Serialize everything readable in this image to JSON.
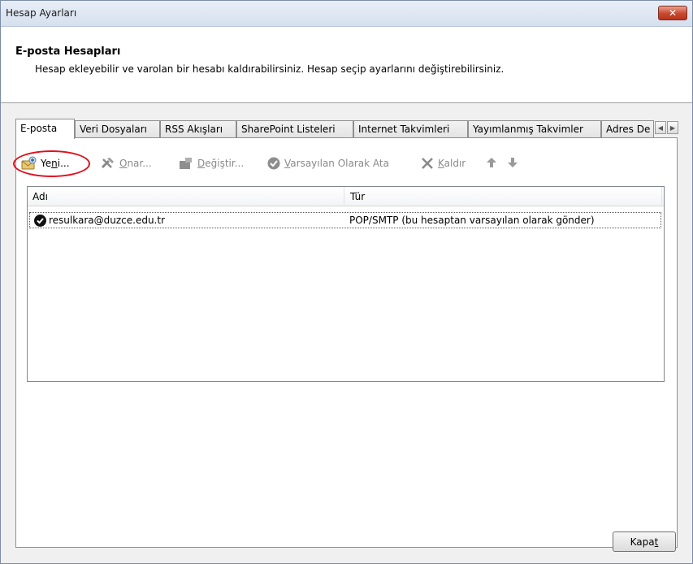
{
  "window": {
    "title": "Hesap Ayarları",
    "close_glyph": "✕"
  },
  "header": {
    "title": "E-posta Hesapları",
    "description": "Hesap ekleyebilir ve varolan bir hesabı kaldırabilirsiniz. Hesap seçip ayarlarını değiştirebilirsiniz."
  },
  "tabs": [
    {
      "label": "E-posta",
      "active": true
    },
    {
      "label": "Veri Dosyaları"
    },
    {
      "label": "RSS Akışları"
    },
    {
      "label": "SharePoint Listeleri"
    },
    {
      "label": "Internet Takvimleri"
    },
    {
      "label": "Yayımlanmış Takvimler"
    },
    {
      "label": "Adres De"
    }
  ],
  "tab_scroll": {
    "left": "◀",
    "right": "▶"
  },
  "toolbar": {
    "new": {
      "prefix": "Ye",
      "underline": "n",
      "suffix": "i...",
      "icon": "new-account-icon",
      "enabled": true
    },
    "repair": {
      "prefix": "",
      "underline": "O",
      "suffix": "nar...",
      "icon": "repair-tools-icon",
      "enabled": false
    },
    "change": {
      "prefix": "",
      "underline": "D",
      "suffix": "eğiştir...",
      "icon": "change-icon",
      "enabled": false
    },
    "set_default": {
      "prefix": "",
      "underline": "V",
      "suffix": "arsayılan Olarak Ata",
      "icon": "check-circle-icon",
      "enabled": false
    },
    "remove": {
      "prefix": "",
      "underline": "K",
      "suffix": "aldır",
      "icon": "x-icon",
      "enabled": false
    },
    "move_up": {
      "icon": "arrow-up-icon"
    },
    "move_down": {
      "icon": "arrow-down-icon"
    }
  },
  "accounts_table": {
    "columns": [
      "Adı",
      "Tür"
    ],
    "rows": [
      {
        "name": "resulkara@duzce.edu.tr",
        "type": "POP/SMTP (bu hesaptan varsayılan olarak gönder)",
        "default": true
      }
    ]
  },
  "footer": {
    "close_prefix": "Kapa",
    "close_underline": "t"
  },
  "colors": {
    "highlight": "#e0101e",
    "close_red": "#c8482d"
  }
}
